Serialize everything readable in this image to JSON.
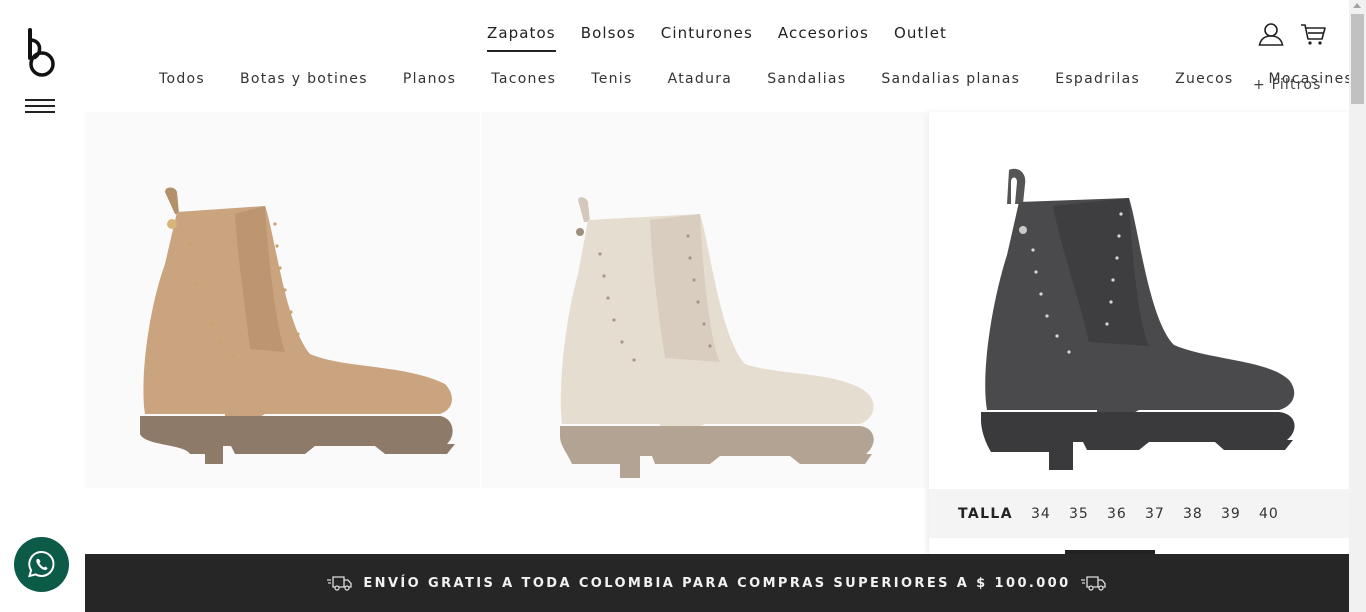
{
  "brand": {
    "logo_icon": "bosi-b-logo-icon"
  },
  "main_nav": [
    {
      "label": "Zapatos",
      "active": true
    },
    {
      "label": "Bolsos",
      "active": false
    },
    {
      "label": "Cinturones",
      "active": false
    },
    {
      "label": "Accesorios",
      "active": false
    },
    {
      "label": "Outlet",
      "active": false
    }
  ],
  "header_icons": [
    "user-icon",
    "cart-icon"
  ],
  "sub_nav": [
    "Todos",
    "Botas y botines",
    "Planos",
    "Tacones",
    "Tenis",
    "Atadura",
    "Sandalias",
    "Sandalias planas",
    "Espadrilas",
    "Zuecos",
    "Mocasines"
  ],
  "filters_label": "+ Filtros",
  "products": [
    {
      "color_name": "camel",
      "color": "#c9a47e",
      "sole": "#8e7a68"
    },
    {
      "color_name": "beige",
      "color": "#e6ddd1",
      "sole": "#b3a393"
    },
    {
      "color_name": "negro",
      "color": "#4a4a4c",
      "sole": "#3a3a3c"
    }
  ],
  "sizes": {
    "label": "TALLA",
    "values": [
      "34",
      "35",
      "36",
      "37",
      "38",
      "39",
      "40"
    ]
  },
  "promo": {
    "text": "ENVÍO GRATIS A TODA COLOMBIA PARA COMPRAS SUPERIORES A $ 100.000"
  },
  "colors": {
    "whatsapp": "#0c5a48",
    "banner": "#262626"
  }
}
